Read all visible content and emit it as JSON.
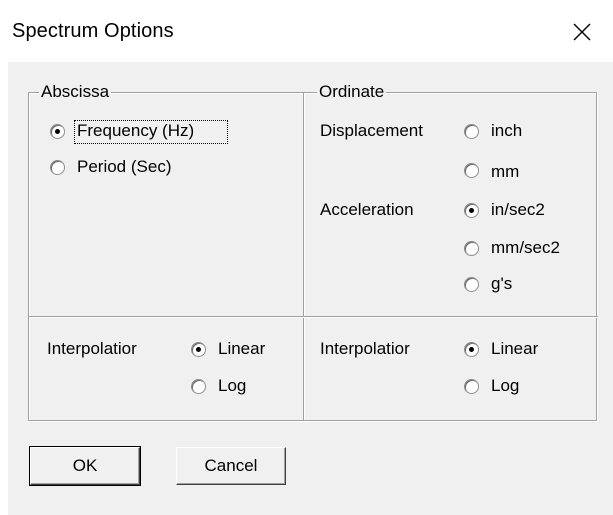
{
  "window": {
    "title": "Spectrum Options",
    "close_icon": "close-icon"
  },
  "abscissa": {
    "legend": "Abscissa",
    "options": [
      {
        "label": "Frequency (Hz)",
        "checked": true
      },
      {
        "label": "Period (Sec)",
        "checked": false
      }
    ],
    "interpolation": {
      "label": "Interpolatior",
      "options": [
        {
          "label": "Linear",
          "checked": true
        },
        {
          "label": "Log",
          "checked": false
        }
      ]
    }
  },
  "ordinate": {
    "legend": "Ordinate",
    "displacement_label": "Displacement",
    "acceleration_label": "Acceleration",
    "displacement_options": [
      {
        "label": "inch",
        "checked": false
      },
      {
        "label": "mm",
        "checked": false
      }
    ],
    "acceleration_options": [
      {
        "label": "in/sec2",
        "checked": true
      },
      {
        "label": "mm/sec2",
        "checked": false
      },
      {
        "label": "g's",
        "checked": false
      }
    ],
    "interpolation": {
      "label": "Interpolatior",
      "options": [
        {
          "label": "Linear",
          "checked": true
        },
        {
          "label": "Log",
          "checked": false
        }
      ]
    }
  },
  "buttons": {
    "ok": "OK",
    "cancel": "Cancel"
  }
}
